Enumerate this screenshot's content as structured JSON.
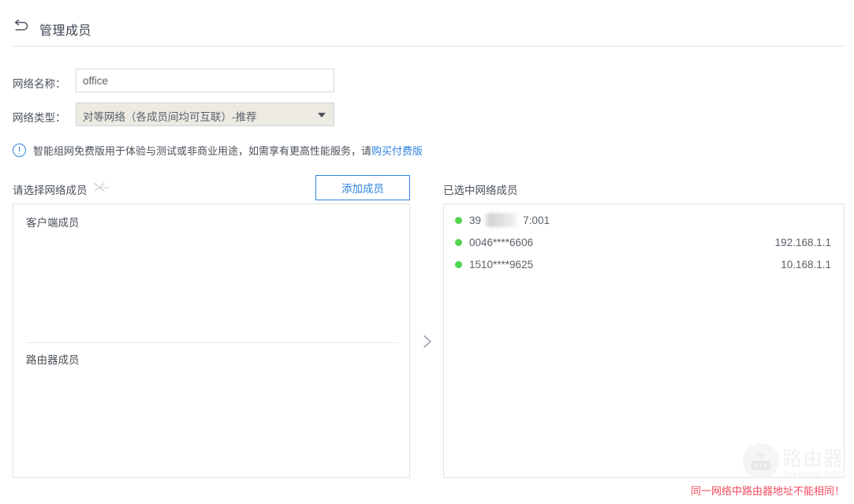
{
  "header": {
    "back_icon": "back-arrow-icon",
    "title": "管理成员"
  },
  "form": {
    "network_name_label": "网络名称：",
    "network_name_value": "office",
    "network_name_placeholder": "",
    "network_type_label": "网络类型：",
    "network_type_value": "对等网络（各成员间均可互联）-推荐",
    "network_type_options": [
      "对等网络（各成员间均可互联）-推荐"
    ]
  },
  "notice": {
    "icon": "info-circle-icon",
    "text": "智能组网免费版用于体验与测试或非商业用途，如需享有更高性能服务，请",
    "link_text": "购买付费版"
  },
  "columns": {
    "left_title": "请选择网络成员",
    "left_title_icon": "network-link-icon",
    "add_member_button": "添加成员",
    "right_title": "已选中网络成员",
    "transfer_icon": "chevron-right-icon"
  },
  "left_panel": {
    "client_group_label": "客户端成员",
    "router_group_label": "路由器成员",
    "client_members": [],
    "router_members": []
  },
  "right_panel": {
    "members": [
      {
        "status": "online",
        "name": "39５▮▮▮▮7:001",
        "name_prefix": "39",
        "name_suffix": "7:001",
        "masked": true,
        "ip": ""
      },
      {
        "status": "online",
        "name": "0046****6606",
        "masked": false,
        "ip": "192.168.1.1"
      },
      {
        "status": "online",
        "name": "1510****9625",
        "masked": false,
        "ip": "10.168.1.1"
      }
    ]
  },
  "footer": {
    "warning": "同一网络中路由器地址不能相同！"
  },
  "watermark": {
    "cn": "路由器",
    "en": "luyouqi.com",
    "icon": "router-signal-icon"
  },
  "colors": {
    "accent": "#2f82e0",
    "warning": "#ef4b5e",
    "online": "#4ed44e",
    "text": "#4a5159",
    "border": "#e2e4e7"
  }
}
